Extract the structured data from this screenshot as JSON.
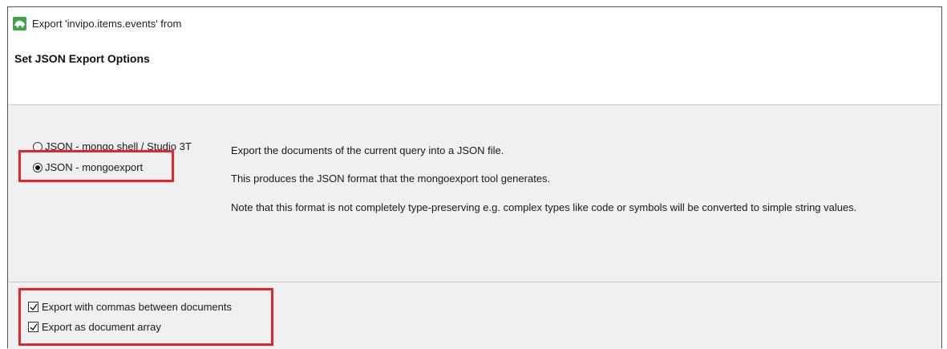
{
  "window": {
    "title": "Export 'invipo.items.events' from",
    "app_icon": "studio3t-icon",
    "heading": "Set JSON Export Options"
  },
  "format_options": [
    {
      "label": "JSON - mongo shell / Studio 3T",
      "selected": false
    },
    {
      "label": "JSON - mongoexport",
      "selected": true
    }
  ],
  "description": {
    "line1": "Export the documents of the current query into a JSON file.",
    "line2": "This produces the JSON format that the mongoexport tool generates.",
    "line3": "Note that this format is not completely type-preserving e.g. complex types like code or symbols will be converted to simple string values."
  },
  "checkbox_options": [
    {
      "label": "Export with commas between documents",
      "checked": true
    },
    {
      "label": "Export as document array",
      "checked": true
    }
  ],
  "colors": {
    "highlight": "#e8232b",
    "panel_bg": "#f0f0f0",
    "icon_green": "#3aa54b"
  }
}
